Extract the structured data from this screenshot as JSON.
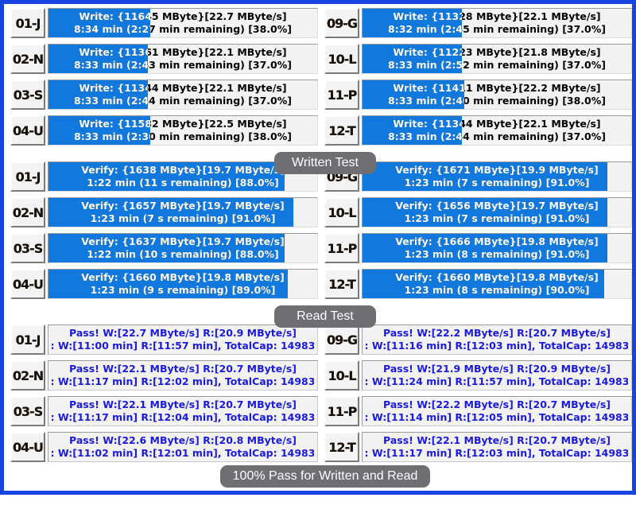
{
  "app": {
    "frame_color": "#1544e0",
    "bar_fill_color": "#1179de",
    "badge_color": "#6e6e73",
    "result_text_color": "#1a1ae0"
  },
  "badges": {
    "written": "Written Test",
    "read": "Read Test",
    "overall": "100% Pass for Written and Read"
  },
  "sections": [
    {
      "name": "write-test",
      "badge": "Written Test",
      "left_column": [
        {
          "slot": "01-J",
          "line1": "Write: {11645 MByte}[22.7 MByte/s]",
          "line2": "8:34 min (2:27 min remaining)   [38.0%]",
          "percent": 38.0,
          "written_mbyte": 11645,
          "speed_mbps": 22.7,
          "elapsed": "8:34 min",
          "remaining": "2:27 min"
        },
        {
          "slot": "02-N",
          "line1": "Write: {11361 MByte}[22.1 MByte/s]",
          "line2": "8:33 min (2:43 min remaining)   [37.0%]",
          "percent": 37.0,
          "written_mbyte": 11361,
          "speed_mbps": 22.1,
          "elapsed": "8:33 min",
          "remaining": "2:43 min"
        },
        {
          "slot": "03-S",
          "line1": "Write: {11344 MByte}[22.1 MByte/s]",
          "line2": "8:33 min (2:44 min remaining)   [37.0%]",
          "percent": 37.0,
          "written_mbyte": 11344,
          "speed_mbps": 22.1,
          "elapsed": "8:33 min",
          "remaining": "2:44 min"
        },
        {
          "slot": "04-U",
          "line1": "Write: {11582 MByte}[22.5 MByte/s]",
          "line2": "8:33 min (2:30 min remaining)   [38.0%]",
          "percent": 38.0,
          "written_mbyte": 11582,
          "speed_mbps": 22.5,
          "elapsed": "8:33 min",
          "remaining": "2:30 min"
        }
      ],
      "right_column": [
        {
          "slot": "09-G",
          "line1": "Write: {11328 MByte}[22.1 MByte/s]",
          "line2": "8:32 min (2:45 min remaining)   [37.0%]",
          "percent": 37.0,
          "written_mbyte": 11328,
          "speed_mbps": 22.1,
          "elapsed": "8:32 min",
          "remaining": "2:45 min"
        },
        {
          "slot": "10-L",
          "line1": "Write: {11223 MByte}[21.8 MByte/s]",
          "line2": "8:33 min (2:52 min remaining)   [37.0%]",
          "percent": 37.0,
          "written_mbyte": 11223,
          "speed_mbps": 21.8,
          "elapsed": "8:33 min",
          "remaining": "2:52 min"
        },
        {
          "slot": "11-P",
          "line1": "Write: {11411 MByte}[22.2 MByte/s]",
          "line2": "8:33 min (2:40 min remaining)   [38.0%]",
          "percent": 38.0,
          "written_mbyte": 11411,
          "speed_mbps": 22.2,
          "elapsed": "8:33 min",
          "remaining": "2:40 min"
        },
        {
          "slot": "12-T",
          "line1": "Write: {11344 MByte}[22.1 MByte/s]",
          "line2": "8:33 min (2:44 min remaining)   [37.0%]",
          "percent": 37.0,
          "written_mbyte": 11344,
          "speed_mbps": 22.1,
          "elapsed": "8:33 min",
          "remaining": "2:44 min"
        }
      ]
    },
    {
      "name": "verify-test",
      "badge": "Read Test",
      "left_column": [
        {
          "slot": "01-J",
          "line1": "Verify: {1638 MByte}[19.7 MByte/s]",
          "line2": "1:22 min (11 s remaining)   [88.0%]",
          "percent": 88.0,
          "verified_mbyte": 1638,
          "speed_mbps": 19.7,
          "elapsed": "1:22 min",
          "remaining": "11 s"
        },
        {
          "slot": "02-N",
          "line1": "Verify: {1657 MByte}[19.7 MByte/s]",
          "line2": "1:23 min (7 s remaining)   [91.0%]",
          "percent": 91.0,
          "verified_mbyte": 1657,
          "speed_mbps": 19.7,
          "elapsed": "1:23 min",
          "remaining": "7 s"
        },
        {
          "slot": "03-S",
          "line1": "Verify: {1637 MByte}[19.7 MByte/s]",
          "line2": "1:22 min (10 s remaining)   [88.0%]",
          "percent": 88.0,
          "verified_mbyte": 1637,
          "speed_mbps": 19.7,
          "elapsed": "1:22 min",
          "remaining": "10 s"
        },
        {
          "slot": "04-U",
          "line1": "Verify: {1660 MByte}[19.8 MByte/s]",
          "line2": "1:23 min (9 s remaining)   [89.0%]",
          "percent": 89.0,
          "verified_mbyte": 1660,
          "speed_mbps": 19.8,
          "elapsed": "1:23 min",
          "remaining": "9 s"
        }
      ],
      "right_column": [
        {
          "slot": "09-G",
          "line1": "Verify: {1671 MByte}[19.9 MByte/s]",
          "line2": "1:23 min (7 s remaining)   [91.0%]",
          "percent": 91.0,
          "verified_mbyte": 1671,
          "speed_mbps": 19.9,
          "elapsed": "1:23 min",
          "remaining": "7 s"
        },
        {
          "slot": "10-L",
          "line1": "Verify: {1656 MByte}[19.7 MByte/s]",
          "line2": "1:23 min (7 s remaining)   [91.0%]",
          "percent": 91.0,
          "verified_mbyte": 1656,
          "speed_mbps": 19.7,
          "elapsed": "1:23 min",
          "remaining": "7 s"
        },
        {
          "slot": "11-P",
          "line1": "Verify: {1666 MByte}[19.8 MByte/s]",
          "line2": "1:23 min (8 s remaining)   [91.0%]",
          "percent": 91.0,
          "verified_mbyte": 1666,
          "speed_mbps": 19.8,
          "elapsed": "1:23 min",
          "remaining": "8 s"
        },
        {
          "slot": "12-T",
          "line1": "Verify: {1660 MByte}[19.8 MByte/s]",
          "line2": "1:23 min (8 s remaining)   [90.0%]",
          "percent": 90.0,
          "verified_mbyte": 1660,
          "speed_mbps": 19.8,
          "elapsed": "1:23 min",
          "remaining": "8 s"
        }
      ]
    },
    {
      "name": "pass-results",
      "badge": "100% Pass for Written and Read",
      "left_column": [
        {
          "slot": "01-J",
          "line1": "Pass! W:[22.7 MByte/s] R:[20.9 MByte/s]",
          "line2": ": W:[11:00 min] R:[11:57 min], TotalCap: 14983",
          "write_speed_mbps": 22.7,
          "read_speed_mbps": 20.9,
          "write_time": "11:00 min",
          "read_time": "11:57 min",
          "total_cap": "14983"
        },
        {
          "slot": "02-N",
          "line1": "Pass! W:[22.1 MByte/s] R:[20.7 MByte/s]",
          "line2": ": W:[11:17 min] R:[12:02 min], TotalCap: 14983",
          "write_speed_mbps": 22.1,
          "read_speed_mbps": 20.7,
          "write_time": "11:17 min",
          "read_time": "12:02 min",
          "total_cap": "14983"
        },
        {
          "slot": "03-S",
          "line1": "Pass! W:[22.1 MByte/s] R:[20.7 MByte/s]",
          "line2": ": W:[11:17 min] R:[12:04 min], TotalCap: 14983",
          "write_speed_mbps": 22.1,
          "read_speed_mbps": 20.7,
          "write_time": "11:17 min",
          "read_time": "12:04 min",
          "total_cap": "14983"
        },
        {
          "slot": "04-U",
          "line1": "Pass! W:[22.6 MByte/s] R:[20.8 MByte/s]",
          "line2": ": W:[11:02 min] R:[12:01 min], TotalCap: 14983",
          "write_speed_mbps": 22.6,
          "read_speed_mbps": 20.8,
          "write_time": "11:02 min",
          "read_time": "12:01 min",
          "total_cap": "14983"
        }
      ],
      "right_column": [
        {
          "slot": "09-G",
          "line1": "Pass! W:[22.2 MByte/s] R:[20.7 MByte/s]",
          "line2": ": W:[11:16 min] R:[12:03 min], TotalCap: 14983",
          "write_speed_mbps": 22.2,
          "read_speed_mbps": 20.7,
          "write_time": "11:16 min",
          "read_time": "12:03 min",
          "total_cap": "14983"
        },
        {
          "slot": "10-L",
          "line1": "Pass! W:[21.9 MByte/s] R:[20.9 MByte/s]",
          "line2": ": W:[11:24 min] R:[11:57 min], TotalCap: 14983",
          "write_speed_mbps": 21.9,
          "read_speed_mbps": 20.9,
          "write_time": "11:24 min",
          "read_time": "11:57 min",
          "total_cap": "14983"
        },
        {
          "slot": "11-P",
          "line1": "Pass! W:[22.2 MByte/s] R:[20.7 MByte/s]",
          "line2": ": W:[11:14 min] R:[12:05 min], TotalCap: 14983",
          "write_speed_mbps": 22.2,
          "read_speed_mbps": 20.7,
          "write_time": "11:14 min",
          "read_time": "12:05 min",
          "total_cap": "14983"
        },
        {
          "slot": "12-T",
          "line1": "Pass! W:[22.1 MByte/s] R:[20.7 MByte/s]",
          "line2": ": W:[11:17 min] R:[12:03 min], TotalCap: 14983",
          "write_speed_mbps": 22.1,
          "read_speed_mbps": 20.7,
          "write_time": "11:17 min",
          "read_time": "12:03 min",
          "total_cap": "14983"
        }
      ]
    }
  ]
}
